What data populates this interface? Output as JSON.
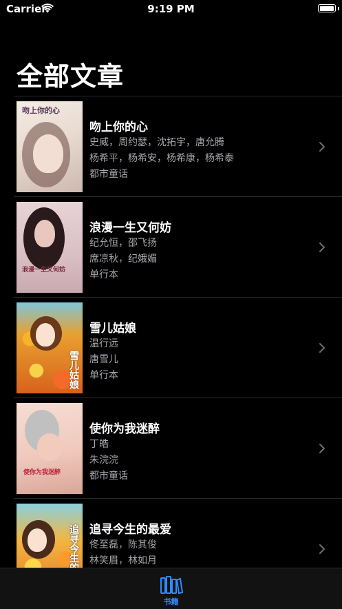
{
  "status_bar": {
    "carrier": "Carrier",
    "time": "9:19 PM",
    "battery_level": 1.0
  },
  "page_title": "全部文章",
  "books": [
    {
      "title": "吻上你的心",
      "line1": "史威，周约瑟，沈拓宇，唐允腾",
      "line2": "杨希平，杨希安，杨希康，杨希泰",
      "line3": "都市童话",
      "cover_text": "吻上你的心",
      "cover_colors": {
        "bg": "#e9dbcf",
        "accent": "#5a3a3a",
        "title": "#5a3a5a"
      }
    },
    {
      "title": "浪漫一生又何妨",
      "line1": "纪允恒，邵飞扬",
      "line2": "席凉秋，纪娥媚",
      "line3": "单行本",
      "cover_text": "浪漫一生又何妨",
      "cover_colors": {
        "bg": "#d9bfc4",
        "accent": "#2a1a1c",
        "title": "#7a2a3a"
      }
    },
    {
      "title": "雪儿姑娘",
      "line1": "温行远",
      "line2": "唐雪儿",
      "line3": "单行本",
      "cover_text": "雪儿姑娘",
      "cover_colors": {
        "bg": "#e8a030",
        "accent": "#7a3a10",
        "title": "#ffffff"
      }
    },
    {
      "title": "使你为我迷醉",
      "line1": "丁皓",
      "line2": "朱浣浣",
      "line3": "都市童话",
      "cover_text": "使你为我迷醉",
      "cover_colors": {
        "bg": "#f0c9bd",
        "accent": "#b08070",
        "title": "#c0203a"
      }
    },
    {
      "title": "追寻今生的最爱",
      "line1": "佟至磊，陈其俊",
      "line2": "林笑眉，林如月",
      "line3": "",
      "cover_text": "追寻今生的最爱",
      "cover_colors": {
        "bg": "#f2b640",
        "accent": "#3a2a20",
        "title": "#ffffff"
      }
    }
  ],
  "tabbar": {
    "books_label": "书籍",
    "active_color": "#2f8cff"
  }
}
